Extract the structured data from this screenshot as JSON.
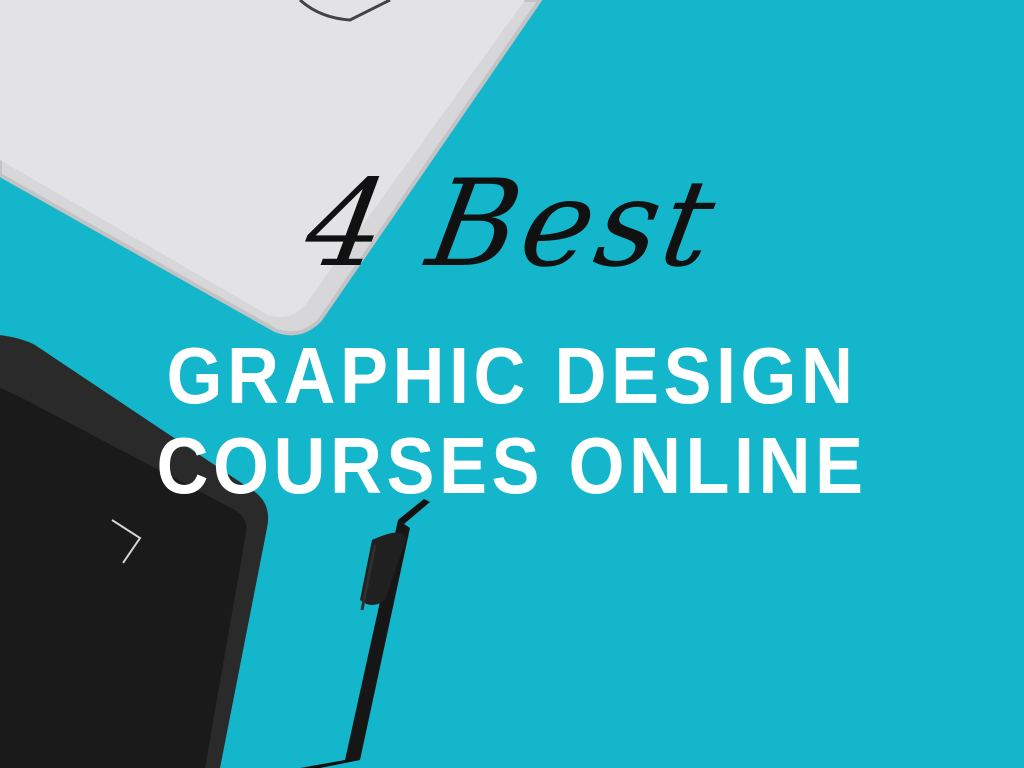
{
  "title": {
    "script": "4 Best",
    "line1": "GRAPHIC DESIGN",
    "line2": "COURSES ONLINE"
  },
  "colors": {
    "background": "#14b6cb",
    "laptop": "#d9d9db",
    "tablet": "#1e1e1f",
    "pen": "#151515",
    "script_text": "#111111",
    "headline_text": "#ffffff"
  },
  "icons": {
    "laptop": "laptop-icon",
    "tablet": "drawing-tablet-icon",
    "pen": "stylus-pen-icon"
  }
}
